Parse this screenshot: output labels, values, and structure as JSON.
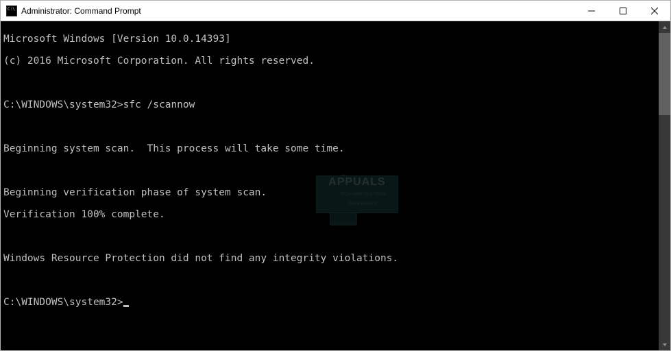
{
  "window": {
    "title": "Administrator: Command Prompt"
  },
  "console": {
    "lines": [
      "Microsoft Windows [Version 10.0.14393]",
      "(c) 2016 Microsoft Corporation. All rights reserved.",
      "",
      "C:\\WINDOWS\\system32>sfc /scannow",
      "",
      "Beginning system scan.  This process will take some time.",
      "",
      "Beginning verification phase of system scan.",
      "Verification 100% complete.",
      "",
      "Windows Resource Protection did not find any integrity violations.",
      ""
    ],
    "version_line": "Microsoft Windows [Version 10.0.14393]",
    "copyright_line": "(c) 2016 Microsoft Corporation. All rights reserved.",
    "prompt1": "C:\\WINDOWS\\system32>",
    "command1": "sfc /scannow",
    "scan_begin": "Beginning system scan.  This process will take some time.",
    "verify_begin": "Beginning verification phase of system scan.",
    "verify_complete": "Verification 100% complete.",
    "result": "Windows Resource Protection did not find any integrity violations.",
    "prompt2": "C:\\WINDOWS\\system32>"
  },
  "watermark": {
    "brand": "APPUALS",
    "tagline_line1": "TECH HOW-TO'S FROM",
    "tagline_line2": "THE EXPERTS!"
  }
}
